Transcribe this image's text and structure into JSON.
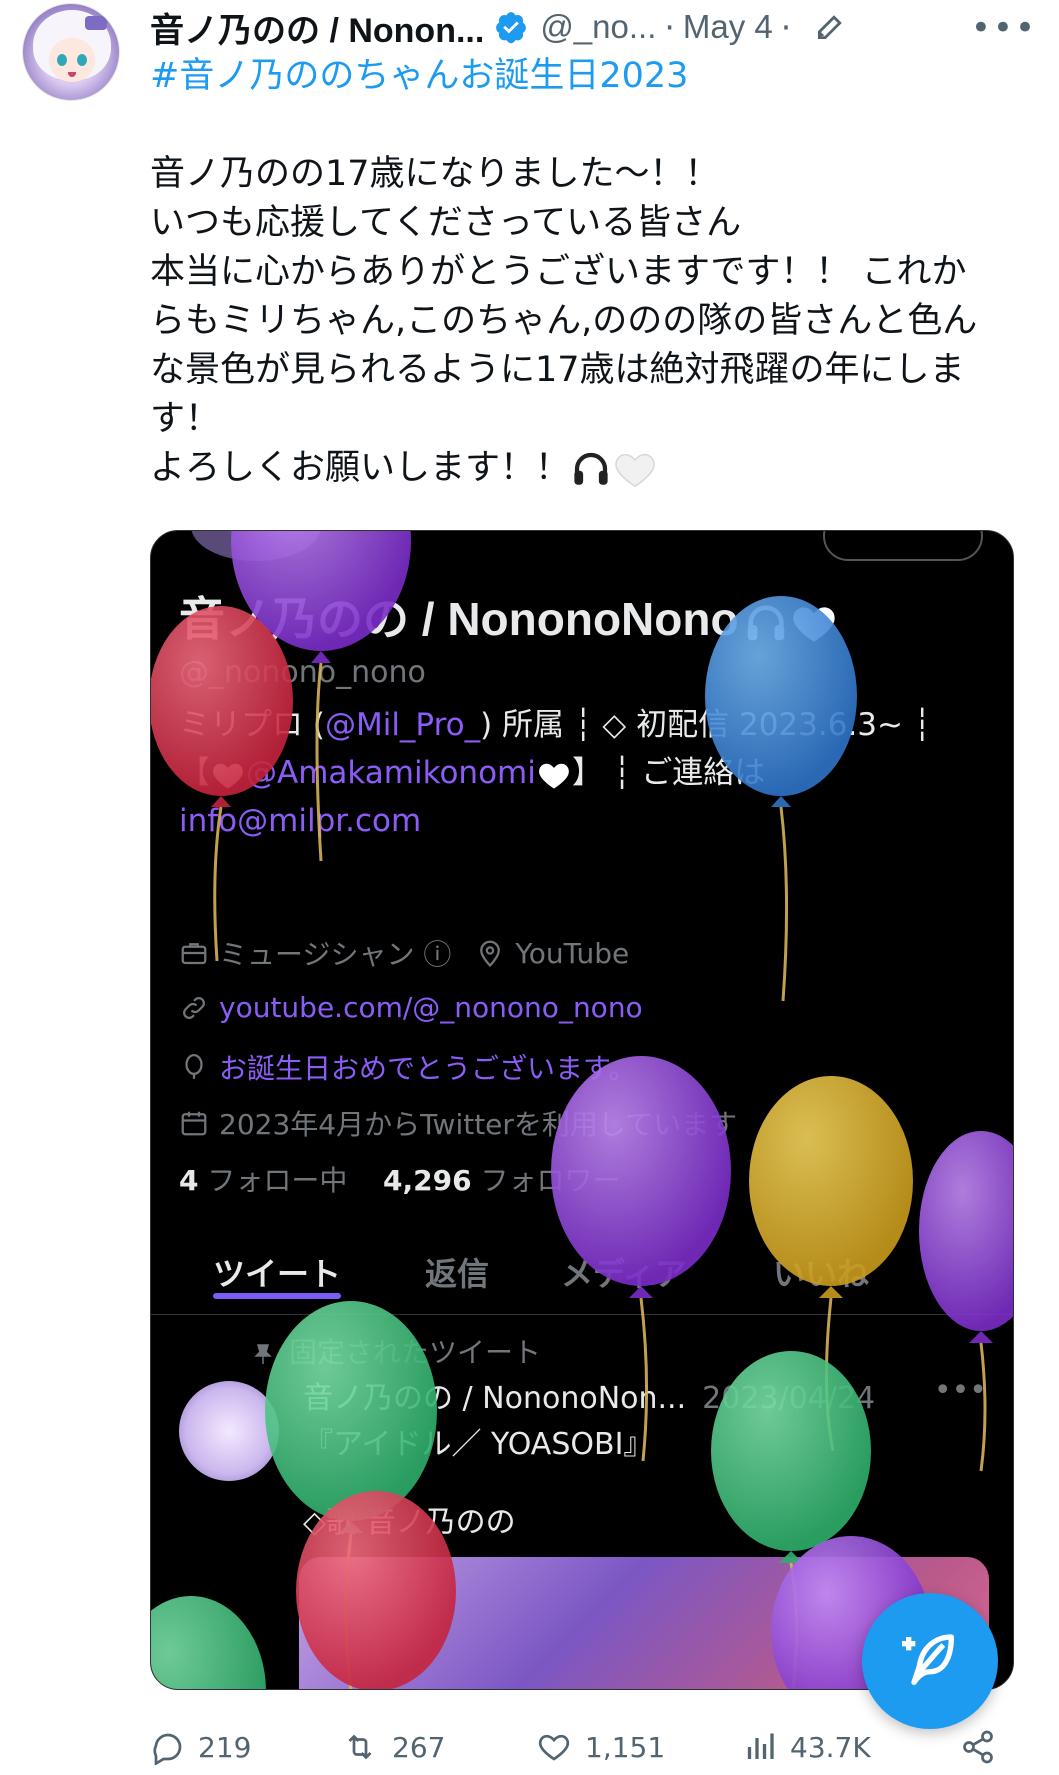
{
  "tweet": {
    "author_name": "音ノ乃のの / Nonon...",
    "author_handle": "@_no...",
    "separator": "·",
    "date": "May 4",
    "more": "•••",
    "hashtag": "#音ノ乃ののちゃんお誕生日2023",
    "lines": [
      "音ノ乃のの17歳になりました〜！！",
      "いつも応援してくださっている皆さん",
      "本当に心からありがとうございますです！！ これか",
      "らもミリちゃん,このちゃん,ののの隊の皆さんと色ん",
      "な景色が見られるように17歳は絶対飛躍の年にしま",
      "す！",
      "よろしくお願いします！！"
    ]
  },
  "media": {
    "profile_name": "音ノ乃のの / NononoNono",
    "profile_handle": "@_nonono_nono",
    "bio_part1": "ミリプロ (",
    "bio_link1": "@Mil_Pro_",
    "bio_part2": ") 所属 ┆ ◇ 初配信 2023.6.3~ ┆",
    "bio_part3": "【",
    "bio_link2": "@Amakamikonomi",
    "bio_part4": "】 ┆ ご連絡は",
    "bio_email": "info@milpr.com",
    "job": "ミュージシャン ⓘ",
    "location": "YouTube",
    "website": "youtube.com/@_nonono_nono",
    "birthday": "お誕生日おめでとうございます。",
    "joined": "2023年4月からTwitterを利用しています",
    "following_count": "4",
    "following_label": "フォロー中",
    "followers_count": "4,296",
    "followers_label": "フォロワー",
    "tabs": [
      "ツイート",
      "返信",
      "メディア",
      "いいね"
    ],
    "pinned_label": "固定されたツイート",
    "pinned_author": "音ノ乃のの / NononoNon...",
    "pinned_date": "2023/04/24",
    "pinned_more": "•••",
    "pinned_text1": "『アイドル／ YOASOBI』",
    "pinned_text2": "◇歌 音ノ乃のの"
  },
  "actions": {
    "replies": "219",
    "retweets": "267",
    "likes": "1,151",
    "views": "43.7K"
  },
  "colors": {
    "link": "#1d9bf0",
    "media_link": "#8b5cf6",
    "muted": "#536471",
    "tab_indicator": "#7c5cf6"
  },
  "icons": {
    "verified": "verified-badge-icon",
    "edit": "edit-pencil-icon",
    "reply": "reply-icon",
    "retweet": "retweet-icon",
    "like": "heart-icon",
    "views": "views-chart-icon",
    "share": "share-icon",
    "compose": "compose-tweet-icon"
  }
}
